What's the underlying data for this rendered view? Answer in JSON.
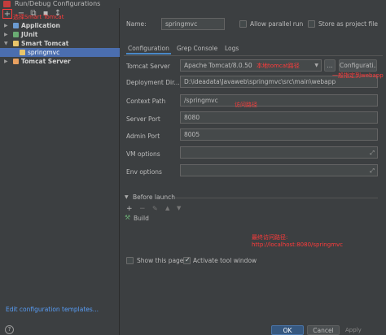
{
  "window": {
    "title": "Run/Debug Configurations"
  },
  "left": {
    "toolbar": {
      "add": "+",
      "remove": "−",
      "copy": "⧉",
      "save": "▪",
      "move": "↕"
    },
    "tree": [
      {
        "label": "Application",
        "icon_color": "#6b9bd2"
      },
      {
        "label": "JUnit",
        "icon_color": "#6aab73"
      },
      {
        "label": "Smart Tomcat",
        "icon_color": "#e8c46a"
      },
      {
        "label": "springmvc",
        "icon_color": "#e8c46a"
      },
      {
        "label": "Tomcat Server",
        "icon_color": "#e8a060"
      }
    ],
    "edit_templates": "Edit configuration templates...",
    "help": "?"
  },
  "annotations": {
    "add_smart_tomcat": "选择Smart Tomcat",
    "tomcat_path": "本地tomcat路径",
    "webapp": "一般指定到webapp",
    "context_path": "访问路径",
    "final_url_title": "最终访问路径:",
    "final_url": "http://localhost:8080/springmvc"
  },
  "form": {
    "name_label": "Name:",
    "name_value": "springmvc",
    "allow_parallel": "Allow parallel run",
    "store_as_file": "Store as project file",
    "tabs": [
      "Configuration",
      "Grep Console",
      "Logs"
    ],
    "tomcat_server_label": "Tomcat Server",
    "tomcat_server_value": "Apache Tomcat/8.0.50",
    "browse_btn": "...",
    "configuration_btn": "Configurati...",
    "deployment_label": "Deployment Dir...",
    "deployment_value": "D:\\ideadata\\Javaweb\\springmvc\\src\\main\\webapp",
    "context_path_label": "Context Path",
    "context_path_value": "/springmvc",
    "server_port_label": "Server Port",
    "server_port_value": "8080",
    "admin_port_label": "Admin Port",
    "admin_port_value": "8005",
    "vm_options_label": "VM options",
    "env_options_label": "Env options",
    "before_launch": "Before launch",
    "before_launch_item": "Build",
    "show_this_page": "Show this page",
    "activate_tool_window": "Activate tool window"
  },
  "footer": {
    "ok": "OK",
    "cancel": "Cancel",
    "apply": "Apply"
  },
  "colors": {
    "bg": "#3c3f41",
    "selection": "#4b6eaf",
    "annotation": "#ff3b3b",
    "link": "#589df6"
  }
}
